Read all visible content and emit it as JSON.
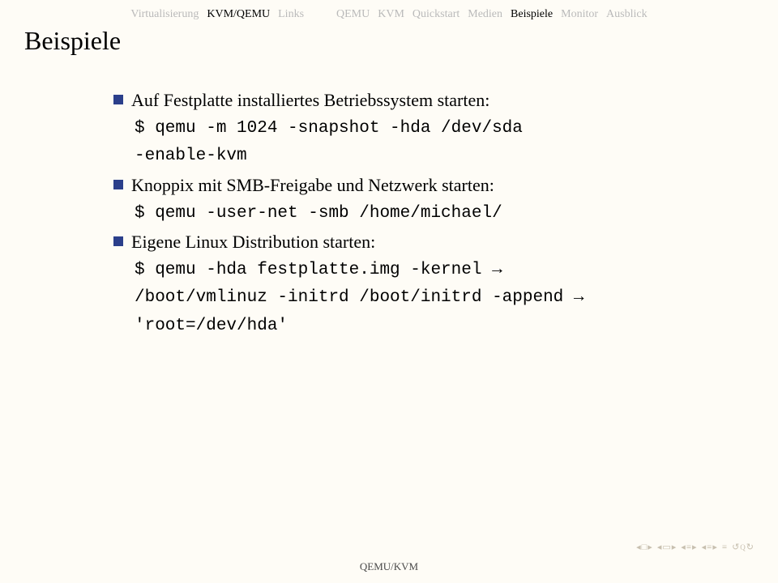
{
  "nav": {
    "left": [
      {
        "label": "Virtualisierung",
        "active": false
      },
      {
        "label": "KVM/QEMU",
        "active": true
      },
      {
        "label": "Links",
        "active": false
      }
    ],
    "right": [
      {
        "label": "QEMU",
        "active": false
      },
      {
        "label": "KVM",
        "active": false
      },
      {
        "label": "Quickstart",
        "active": false
      },
      {
        "label": "Medien",
        "active": false
      },
      {
        "label": "Beispiele",
        "active": true
      },
      {
        "label": "Monitor",
        "active": false
      },
      {
        "label": "Ausblick",
        "active": false
      }
    ]
  },
  "title": "Beispiele",
  "items": [
    {
      "text": "Auf Festplatte installiertes Betriebssystem starten:",
      "code": [
        "$ qemu -m 1024 -snapshot -hda /dev/sda",
        "-enable-kvm"
      ]
    },
    {
      "text": "Knoppix mit SMB-Freigabe und Netzwerk starten:",
      "code": [
        "$ qemu -user-net -smb /home/michael/"
      ]
    },
    {
      "text": "Eigene Linux Distribution starten:",
      "code": [
        "$ qemu -hda festplatte.img -kernel →",
        "/boot/vmlinuz -initrd /boot/initrd -append →",
        "'root=/dev/hda'"
      ]
    }
  ],
  "footer": "QEMU/KVM"
}
